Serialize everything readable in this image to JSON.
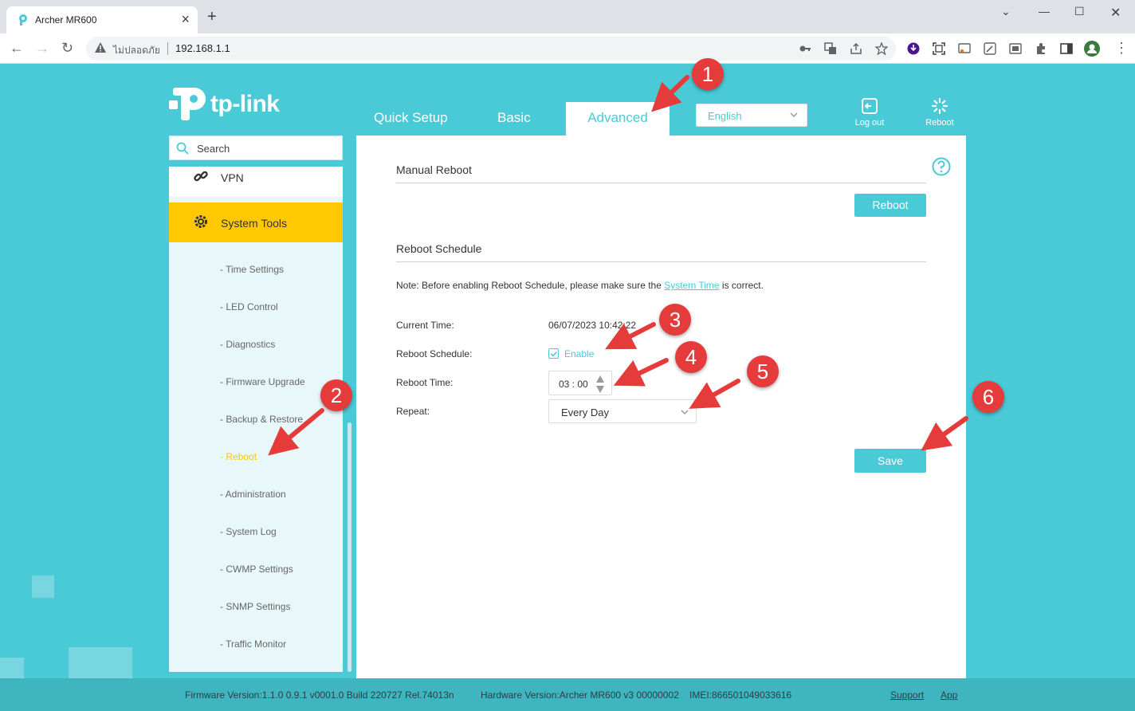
{
  "browser": {
    "tab_title": "Archer MR600",
    "insecure_label": "ไม่ปลอดภัย",
    "url": "192.168.1.1"
  },
  "router": {
    "logo_text": "tp-link",
    "nav": {
      "quick_setup": "Quick Setup",
      "basic": "Basic",
      "advanced": "Advanced",
      "language": "English",
      "logout": "Log out",
      "reboot": "Reboot"
    },
    "sidebar": {
      "search_placeholder": "Search",
      "vpn": "VPN",
      "system_tools": "System Tools",
      "items": [
        "- Time Settings",
        "- LED Control",
        "- Diagnostics",
        "- Firmware Upgrade",
        "- Backup & Restore",
        "- Reboot",
        "- Administration",
        "- System Log",
        "- CWMP Settings",
        "- SNMP Settings",
        "- Traffic Monitor"
      ],
      "active_index": 5
    },
    "main": {
      "manual_reboot_title": "Manual Reboot",
      "reboot_button": "Reboot",
      "schedule_title": "Reboot Schedule",
      "note_prefix": "Note: Before enabling Reboot Schedule, please make sure the ",
      "note_link": "System Time",
      "note_suffix": " is correct.",
      "current_time_label": "Current Time:",
      "current_time_value": "06/07/2023 10:42:22",
      "schedule_label": "Reboot Schedule:",
      "enable_label": "Enable",
      "enable_checked": true,
      "time_label": "Reboot Time:",
      "time_value": "03 : 00",
      "repeat_label": "Repeat:",
      "repeat_value": "Every Day",
      "save_button": "Save"
    },
    "footer": {
      "firmware": "Firmware Version:1.1.0 0.9.1 v0001.0 Build 220727 Rel.74013n",
      "hardware": "Hardware Version:Archer MR600 v3 00000002",
      "imei": "IMEI:866501049033616",
      "support": "Support",
      "app": "App"
    }
  },
  "annotations": [
    "1",
    "2",
    "3",
    "4",
    "5",
    "6"
  ],
  "colors": {
    "brand": "#4ac9d6",
    "highlight": "#ffc800",
    "annotation": "#e63b3b"
  }
}
